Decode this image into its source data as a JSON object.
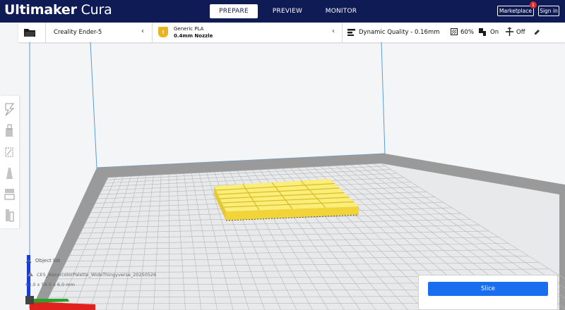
{
  "header": {
    "brand_bold": "Ultimaker",
    "brand_light": " Cura",
    "stages": [
      {
        "label": "PREPARE",
        "active": true
      },
      {
        "label": "PREVIEW",
        "active": false
      },
      {
        "label": "MONITOR",
        "active": false
      }
    ],
    "marketplace_label": "Marketplace",
    "marketplace_badge": "1",
    "signin_label": "Sign in"
  },
  "toolbar": {
    "printer": "Creality Ender-5",
    "material_name": "Generic PLA",
    "nozzle": "0.4mm Nozzle",
    "material_badge": "!",
    "profile": "Dynamic Quality - 0.16mm",
    "infill": "60%",
    "support": "On",
    "adhesion": "Off"
  },
  "tools": [
    "move-tool",
    "scale-tool",
    "rotate-tool",
    "mirror-tool",
    "per-model-settings-tool",
    "support-blocker-tool"
  ],
  "object_info": {
    "list_label": "Object list",
    "name": "CE5_WatercolorPalette_WideThingyverse_20250526",
    "dims": "63.0 x 58.0 x 6.0 mm"
  },
  "slice": {
    "button_label": "Slice"
  },
  "colors": {
    "header_bg": "#0f1b54",
    "accent": "#196ef0",
    "model": "#f7e25a",
    "warning": "#e8b521"
  }
}
